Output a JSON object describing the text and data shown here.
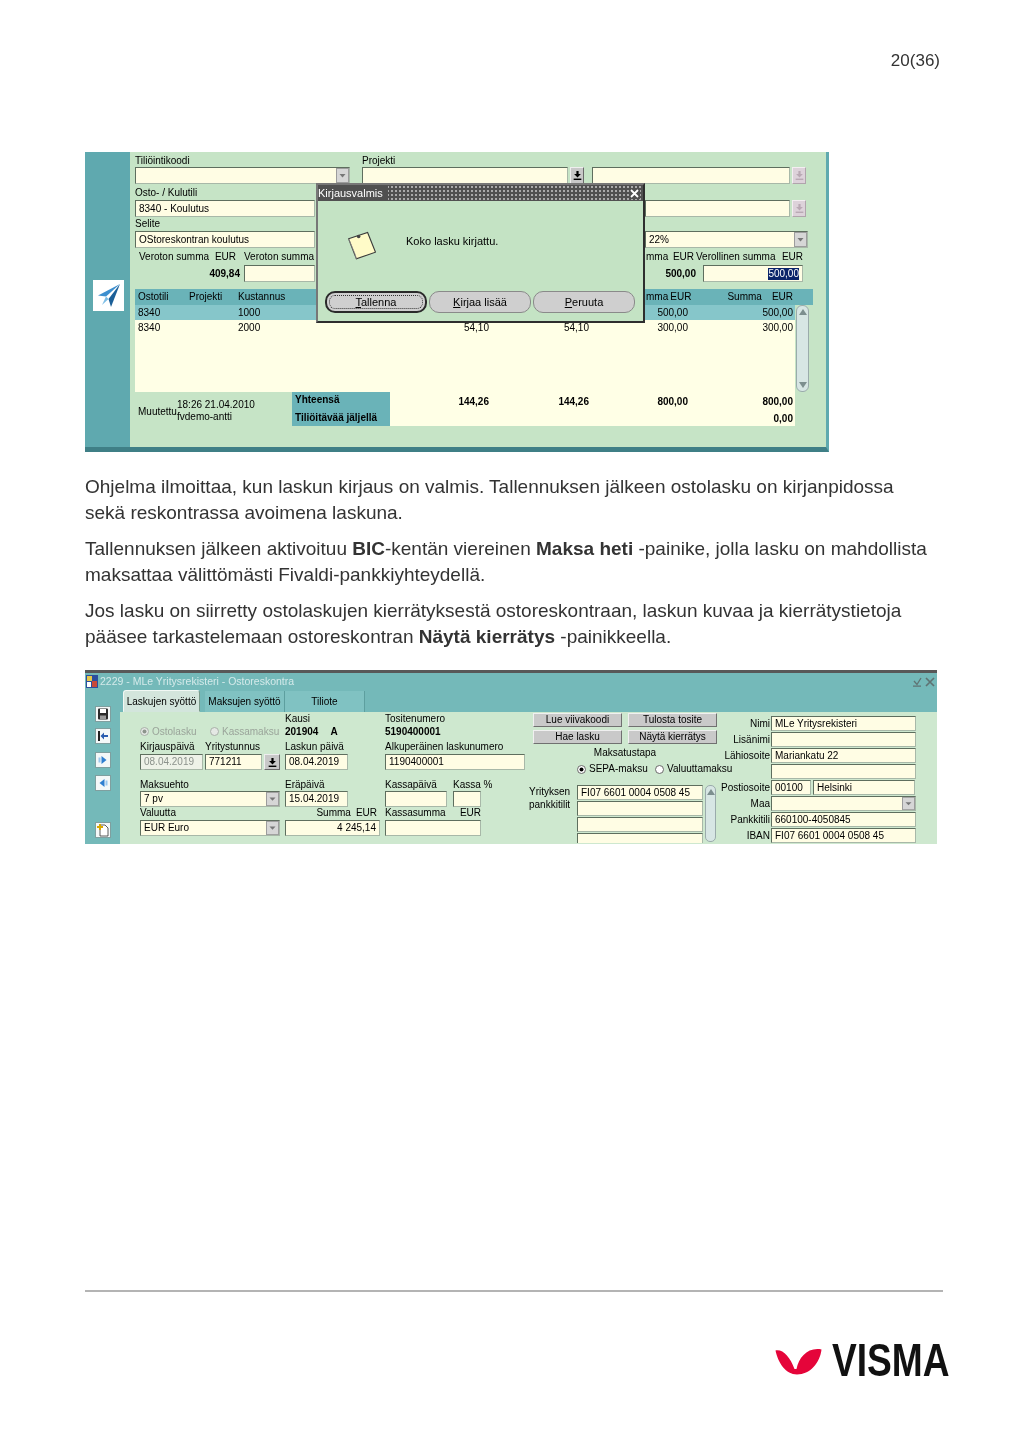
{
  "page_number": "20(36)",
  "posting_window": {
    "account_code": {
      "label": "Tiliöintikoodi"
    },
    "project": {
      "label": "Projekti",
      "lookup": {
        "disabled": false
      }
    },
    "project_name": {
      "lookup": {
        "disabled": true
      }
    },
    "account": {
      "label": "Osto- / Kulutili",
      "value": "8340 - Koulutus"
    },
    "account_name": {
      "lookup": {
        "disabled": true
      }
    },
    "description": {
      "label": "Selite",
      "value": "OStoreskontran koulutus"
    },
    "vat_rate": {
      "value": "22%"
    },
    "net_total": {
      "label": "Veroton summa",
      "currency": "EUR",
      "value": "409,84"
    },
    "net_amount": {
      "label": "Veroton summa"
    },
    "gross_total": {
      "label": "mma",
      "currency": "EUR",
      "value": "500,00"
    },
    "gross_amount": {
      "label": "Verollinen summa",
      "currency": "EUR",
      "value": "500,00",
      "selected": true
    },
    "lines": {
      "columns": [
        "Ostotili",
        "Projekti",
        "Kustannus"
      ],
      "amount_columns": [
        {
          "label": "mma",
          "currency": "EUR"
        },
        {
          "label": "Summa",
          "currency": "EUR"
        }
      ],
      "rows": [
        {
          "selected": true,
          "ostotili": "8340",
          "kustannus": "1000",
          "column_6": "500,00",
          "summa": "500,00"
        },
        {
          "selected": false,
          "ostotili": "8340",
          "kustannus": "2000",
          "column_4": "54,10",
          "column_5": "54,10",
          "column_6": "300,00",
          "summa": "300,00"
        }
      ]
    },
    "changed": {
      "label": "Muutettu",
      "time": "18:26 21.04.2010",
      "user": "fvdemo-antti"
    },
    "totals": [
      {
        "label": "Yhteensä",
        "values": [
          "144,26",
          "144,26",
          "800,00",
          "800,00"
        ]
      },
      {
        "label": "Tiliöitävää jäljellä",
        "values": [
          "0,00"
        ]
      }
    ],
    "dialog": {
      "title": "Kirjausvalmis",
      "message": "Koko lasku kirjattu.",
      "buttons": [
        {
          "label": "Tallenna",
          "focused": true
        },
        {
          "label": "Kirjaa lisää",
          "focused": false
        },
        {
          "label": "Peruuta",
          "focused": false
        }
      ]
    }
  },
  "paragraphs": [
    "Ohjelma ilmoittaa, kun laskun kirjaus on valmis. Tallennuksen jälkeen ostolasku on kirjanpidossa sekä reskontrassa avoimena laskuna.",
    "Tallennuksen jälkeen aktivoituu **BIC**-kentän viereinen **Maksa heti** -painike, jolla lasku on mahdollista maksattaa välittömästi Fivaldi-pankkiyhteydellä.",
    "Jos lasku on siirretty ostolaskujen kierrätyksestä ostoreskontraan, laskun kuvaa ja kierrätystietoja pääsee tarkastelemaan ostoreskontran **Näytä kierrätys** -painikkeella."
  ],
  "ledger_window": {
    "title": "2229 - MLe Yritysrekisteri - Ostoreskontra",
    "tabs": [
      {
        "label": "Laskujen syöttö",
        "selected": true
      },
      {
        "label": "Maksujen syöttö",
        "selected": false
      },
      {
        "label": "Tiliote",
        "selected": false
      }
    ],
    "invoice_type": [
      {
        "label": "Ostolasku",
        "selected": true,
        "disabled": true
      },
      {
        "label": "Kassamaksu",
        "selected": false,
        "disabled": true
      }
    ],
    "period": {
      "label": "Kausi",
      "value": "201904",
      "suffix": "A"
    },
    "voucher_number": {
      "label": "Tositenumero",
      "value": "5190400001"
    },
    "entry_date": {
      "label": "Kirjauspäivä",
      "value": "08.04.2019",
      "disabled": true
    },
    "business_id": {
      "label": "Yritystunnus",
      "value": "771211"
    },
    "invoice_date": {
      "label": "Laskun päivä",
      "value": "08.04.2019"
    },
    "original_invoice_number": {
      "label": "Alkuperäinen laskunumero",
      "value": "1190400001"
    },
    "payment_terms": {
      "label": "Maksuehto",
      "value": "7 pv"
    },
    "due_date": {
      "label": "Eräpäivä",
      "value": "15.04.2019"
    },
    "discount_date": {
      "label": "Kassapäivä"
    },
    "discount_percent": {
      "label": "Kassa %"
    },
    "currency": {
      "label": "Valuutta",
      "value": "EUR Euro"
    },
    "amount": {
      "label": "Summa",
      "currency": "EUR",
      "value": "4 245,14"
    },
    "discount_amount": {
      "label": "Kassasumma",
      "currency": "EUR"
    },
    "action_buttons": [
      "Lue viivakoodi",
      "Tulosta tosite",
      "Hae lasku",
      "Näytä kierrätys"
    ],
    "payment_method": {
      "label": "Maksatustapa",
      "options": [
        {
          "label": "SEPA-maksu",
          "selected": true
        },
        {
          "label": "Valuuttamaksu",
          "selected": false
        }
      ]
    },
    "bank_accounts": {
      "label": "Yrityksen pankkitilit",
      "values": [
        "FI07 6601 0004 0508 45"
      ]
    },
    "supplier_fields": [
      {
        "kind": "text",
        "label": "Nimi",
        "value": "MLe Yritysrekisteri"
      },
      {
        "kind": "text",
        "label": "Lisänimi"
      },
      {
        "kind": "text",
        "label": "Lähiosoite",
        "value": "Mariankatu 22"
      },
      {
        "kind": "text"
      },
      {
        "kind": "postal",
        "label": "Postiosoite",
        "values": [
          "00100",
          "Helsinki"
        ]
      },
      {
        "kind": "dropdown",
        "label": "Maa"
      },
      {
        "kind": "text",
        "label": "Pankkitili",
        "value": "660100-4050845"
      },
      {
        "kind": "text",
        "label": "IBAN",
        "value": "FI07 6601 0004 0508 45"
      }
    ]
  },
  "logo": {
    "wordmark": "VISMA"
  }
}
